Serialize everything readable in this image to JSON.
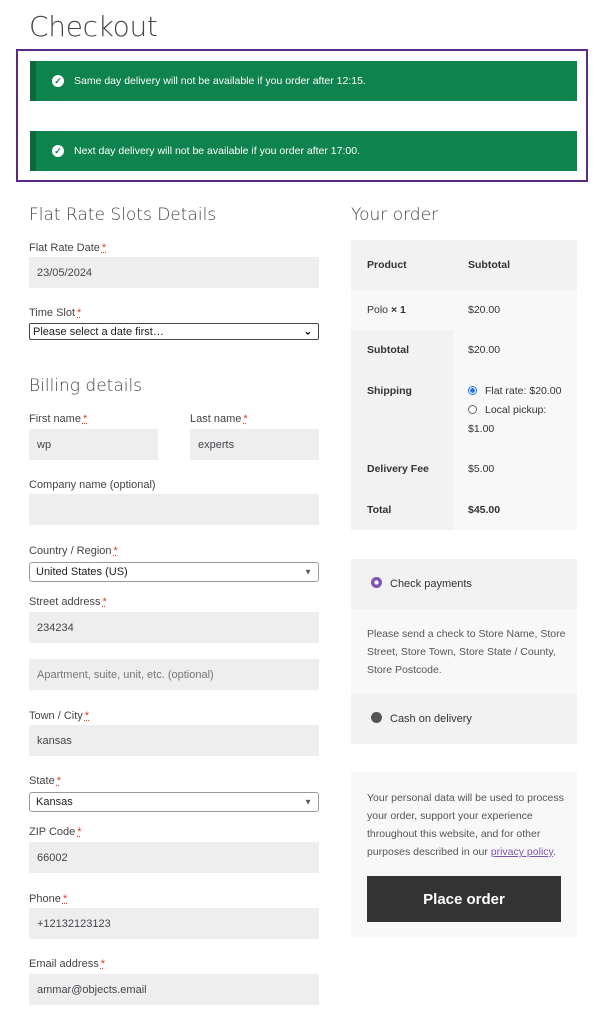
{
  "page": {
    "title": "Checkout"
  },
  "notices": [
    {
      "text": "Same day delivery will not be available if you order after 12:15."
    },
    {
      "text": "Next day delivery will not be available if you order after 17:00."
    }
  ],
  "slots": {
    "title": "Flat Rate Slots Details",
    "date_label": "Flat Rate Date",
    "date_value": "23/05/2024",
    "time_label": "Time Slot",
    "time_value": "Please select a date first…"
  },
  "billing": {
    "title": "Billing details",
    "required_mark": "*",
    "first_name_label": "First name",
    "first_name_value": "wp",
    "last_name_label": "Last name",
    "last_name_value": "experts",
    "company_label": "Company name (optional)",
    "company_value": "",
    "country_label": "Country / Region",
    "country_value": "United States (US)",
    "street_label": "Street address",
    "street_value": "234234",
    "apartment_placeholder": "Apartment, suite, unit, etc. (optional)",
    "city_label": "Town / City",
    "city_value": "kansas",
    "state_label": "State",
    "state_value": "Kansas",
    "zip_label": "ZIP Code",
    "zip_value": "66002",
    "phone_label": "Phone",
    "phone_value": "+12132123123",
    "email_label": "Email address",
    "email_value": "ammar@objects.email"
  },
  "order": {
    "title": "Your order",
    "col_product": "Product",
    "col_subtotal": "Subtotal",
    "item_name": "Polo",
    "item_qty": "× 1",
    "item_price": "$20.00",
    "subtotal_label": "Subtotal",
    "subtotal_value": "$20.00",
    "shipping_label": "Shipping",
    "shipping_option1": "Flat rate: $20.00",
    "shipping_option2_line1": "Local pickup:",
    "shipping_option2_line2": "$1.00",
    "fee_label": "Delivery Fee",
    "fee_value": "$5.00",
    "total_label": "Total",
    "total_value": "$45.00"
  },
  "payment": {
    "check_label": "Check payments",
    "check_description": "Please send a check to Store Name, Store Street, Store Town, Store State / County, Store Postcode.",
    "cod_label": "Cash on delivery",
    "privacy_text_before": "Your personal data will be used to process your order, support your experience throughout this website, and for other purposes described in our ",
    "privacy_link": "privacy policy",
    "privacy_text_after": ".",
    "place_order_label": "Place order"
  },
  "colors": {
    "notice_green": "#0f834d",
    "highlight_border": "#5b2a86",
    "accent_purple": "#7f54b3",
    "required_red": "#e2401c",
    "button_dark": "#333333"
  }
}
